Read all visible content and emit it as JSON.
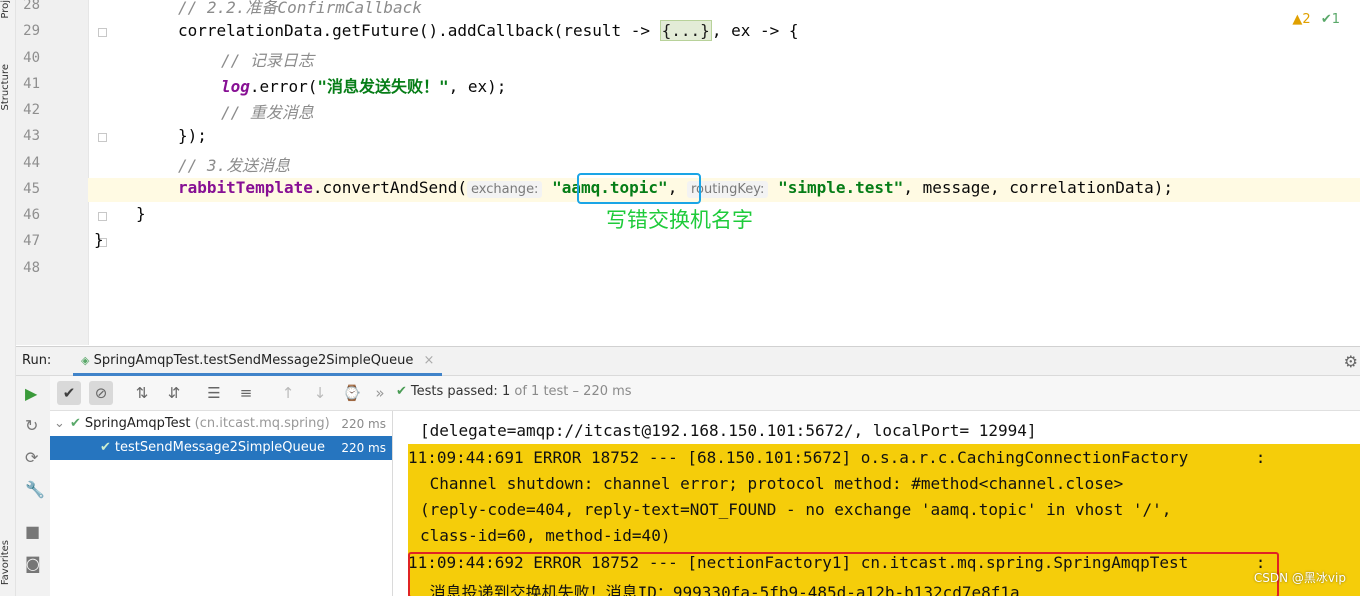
{
  "side": {
    "project": "Proj",
    "structure": "Structure",
    "favorites": "Favorites"
  },
  "editor": {
    "inspections": {
      "warnings": "▲2",
      "checks": "✔1"
    },
    "lines": [
      {
        "num": "28",
        "comment": "// 2.2.准备ConfirmCallback"
      },
      {
        "num": "29",
        "a": "correlationData.getFuture().addCallback(result -> ",
        "folded": "{...}",
        "b": ", ex -> {"
      },
      {
        "num": "40",
        "comment": "// 记录日志"
      },
      {
        "num": "41",
        "log": "log",
        "a": ".error(",
        "str": "\"消息发送失败！\"",
        "b": ", ex);"
      },
      {
        "num": "42",
        "comment": "// 重发消息"
      },
      {
        "num": "43",
        "text": "});"
      },
      {
        "num": "44",
        "comment": "// 3.发送消息"
      },
      {
        "num": "45",
        "obj": "rabbitTemplate",
        "a": ".convertAndSend(",
        "hint1": "exchange:",
        "str1": "\"aamq.topic\"",
        "sep": ",",
        "hint2": "routingKey:",
        "str2": "\"simple.test\"",
        "b": ", message, correlationData);"
      },
      {
        "num": "46",
        "text": "}"
      },
      {
        "num": "47",
        "text": "}"
      },
      {
        "num": "48",
        "text": ""
      }
    ],
    "annotation": "写错交换机名字"
  },
  "run": {
    "label": "Run:",
    "tab": "SpringAmqpTest.testSendMessage2SimpleQueue",
    "status": {
      "passed": "Tests passed:",
      "count": "1",
      "rest": "of 1 test – 220 ms"
    },
    "tree": [
      {
        "name": "SpringAmqpTest",
        "pkg": "(cn.itcast.mq.spring)",
        "time": "220 ms"
      },
      {
        "name": "testSendMessage2SimpleQueue",
        "time": "220 ms"
      }
    ],
    "console": [
      "[delegate=amqp://itcast@192.168.150.101:5672/, localPort= 12994]",
      "11:09:44:691 ERROR 18752 --- [68.150.101:5672] o.s.a.r.c.CachingConnectionFactory       :",
      " Channel shutdown: channel error; protocol method: #method<channel.close>",
      "(reply-code=404, reply-text=NOT_FOUND - no exchange 'aamq.topic' in vhost '/',",
      "class-id=60, method-id=40)",
      "11:09:44:692 ERROR 18752 --- [nectionFactory1] cn.itcast.mq.spring.SpringAmqpTest       :",
      " 消息投递到交换机失败！消息ID：999330fa-5fb9-485d-a12b-b132cd7e8f1a"
    ]
  },
  "watermark": "CSDN @黑冰vip"
}
